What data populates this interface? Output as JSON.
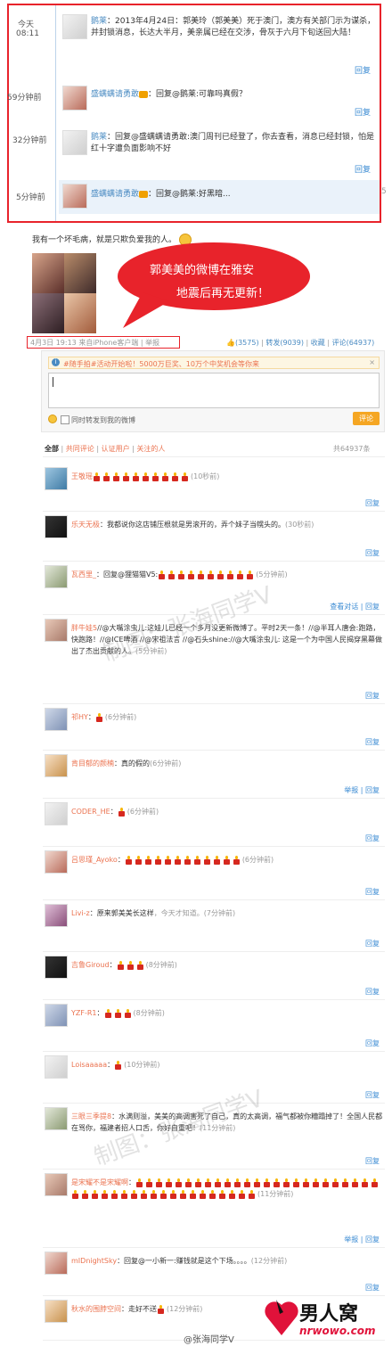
{
  "top": {
    "time1": "今天",
    "time2": "08:11",
    "c1_name": "鹅莱",
    "c1_text": "：2013年4月24日：郭美玲（郭美美）死于澳门，澳方有关部门示为谋杀，并封锁消息，长达大半月，美亲属已经在交涉，骨灰于六月下旬送回大陆！",
    "c1_reply": "回复",
    "c2_time": "59分钟前",
    "c2_name": "盛螨螨请勇敢",
    "c2_text": "：回复@鹅莱:可靠吗真假？",
    "c2_reply": "回复",
    "c3_time": "32分钟前",
    "c3_name": "鹅莱",
    "c3_text": "：回复@盛螨螨请勇敢:澳门周刊已经登了，你去查看，消息已经封锁，怕是红十字遭负面影响不好",
    "c3_reply": "回复",
    "c4_time": "5分钟前",
    "c4_name": "盛螨螨请勇敢",
    "c4_text": "：回复@鹅莱:好黑暗...",
    "c4_edge": "5"
  },
  "post": {
    "text": "我有一个坏毛病，就是只欺负爱我的人。",
    "bubble_line1": "郭美美的微博在雅安",
    "bubble_line2": "地震后再无更新！",
    "meta": "4月3日 19:13 来自iPhone客户端 | 举报",
    "like": "(3575)",
    "repost": "转发(9039)",
    "fav": "收藏",
    "comment": "评论(64937)"
  },
  "composer": {
    "banner": "#随手拍#活动开始啦！5000万巨奖、10万个中奖机会等你来",
    "checkbox_label": "同时转发到我的微博",
    "submit": "评论"
  },
  "filters": {
    "all": "全部",
    "mutual": "共同评论",
    "verified": "认证用户",
    "following": "关注的人",
    "total": "共64937条"
  },
  "watermark": "制图：张海同学V",
  "comments": [
    {
      "name": "王敬瑶",
      "text": "",
      "candles": 10,
      "time": "(10秒前)",
      "actions": "回复"
    },
    {
      "name": "乐天无极",
      "text": "：我都说你这店铺压根就是男滚开的，弄个妹子当幌头的。",
      "candles": 0,
      "time": "(30秒前)",
      "actions": "回复"
    },
    {
      "name": "瓦西里_",
      "text": "：回复@狸猫猫V5:",
      "candles": 10,
      "time": "(5分钟前)",
      "actions": "查看对话 | 回复"
    },
    {
      "name": "胖牛娃5",
      "text": "//@大嘴涂虫儿:这娃儿已经一个多月没更新微博了。平时2天一条！//@半耳人唐会:跑路，快跑路！//@ICE啤酒 //@宋祖法言 //@石头shine://@大嘴涂虫儿: 这是一个为中国人民揭穿黑幕做出了杰出贡献的人。",
      "candles": 0,
      "time": "(5分钟前)",
      "actions": "回复"
    },
    {
      "name": "祁HY",
      "text": "：",
      "candles": 1,
      "time": "(6分钟前)",
      "actions": "回复"
    },
    {
      "name": "肯目郁的颜楠",
      "text": "：真的假的",
      "candles": 0,
      "time": "(6分钟前)",
      "actions": "举报 | 回复"
    },
    {
      "name": "CODER_HE",
      "text": "：",
      "candles": 1,
      "time": "(6分钟前)",
      "actions": "回复"
    },
    {
      "name": "吕思瑾_Ayoko",
      "text": "：",
      "candles": 12,
      "time": "(6分钟前)",
      "actions": "回复"
    },
    {
      "name": "Livi-z",
      "text": "：原来郭美美长这样",
      "candles": 0,
      "time": "，今天才知道。(7分钟前)",
      "actions": "回复"
    },
    {
      "name": "吉鲁Giroud",
      "text": "：",
      "candles": 3,
      "time": "(8分钟前)",
      "actions": "回复"
    },
    {
      "name": "YZF-R1",
      "text": "：",
      "candles": 3,
      "time": "(8分钟前)",
      "actions": "回复"
    },
    {
      "name": "Loisaaaaa",
      "text": "：",
      "candles": 1,
      "time": "(10分钟前)",
      "actions": "回复"
    },
    {
      "name": "三眼三季提8",
      "text": "：水满则溢，美美的高调害死了自己，真的太高调，福气都被你糟蹋掉了！全国人民都在骂你，福建者招人口舌，你好自重吧！",
      "candles": 0,
      "time": "(11分钟前)",
      "actions": "回复"
    },
    {
      "name": "是宋耀不是宋耀啊",
      "text": "：",
      "candles": 44,
      "time": "(11分钟前)",
      "actions": "举报 | 回复"
    },
    {
      "name": "mIDnightSky",
      "text": "：回复@一小新一:赚钱就是这个下场。。。。",
      "candles": 0,
      "time": "(12分钟前)",
      "actions": "回复"
    },
    {
      "name": "秋水的围脖空间",
      "text": "：走好不送",
      "candles": 1,
      "time": "(12分钟前)",
      "actions": ""
    }
  ],
  "footer": {
    "credit": "@张海同学V",
    "logo_main": "男人窝",
    "logo_sub": "nrwowo.com"
  }
}
